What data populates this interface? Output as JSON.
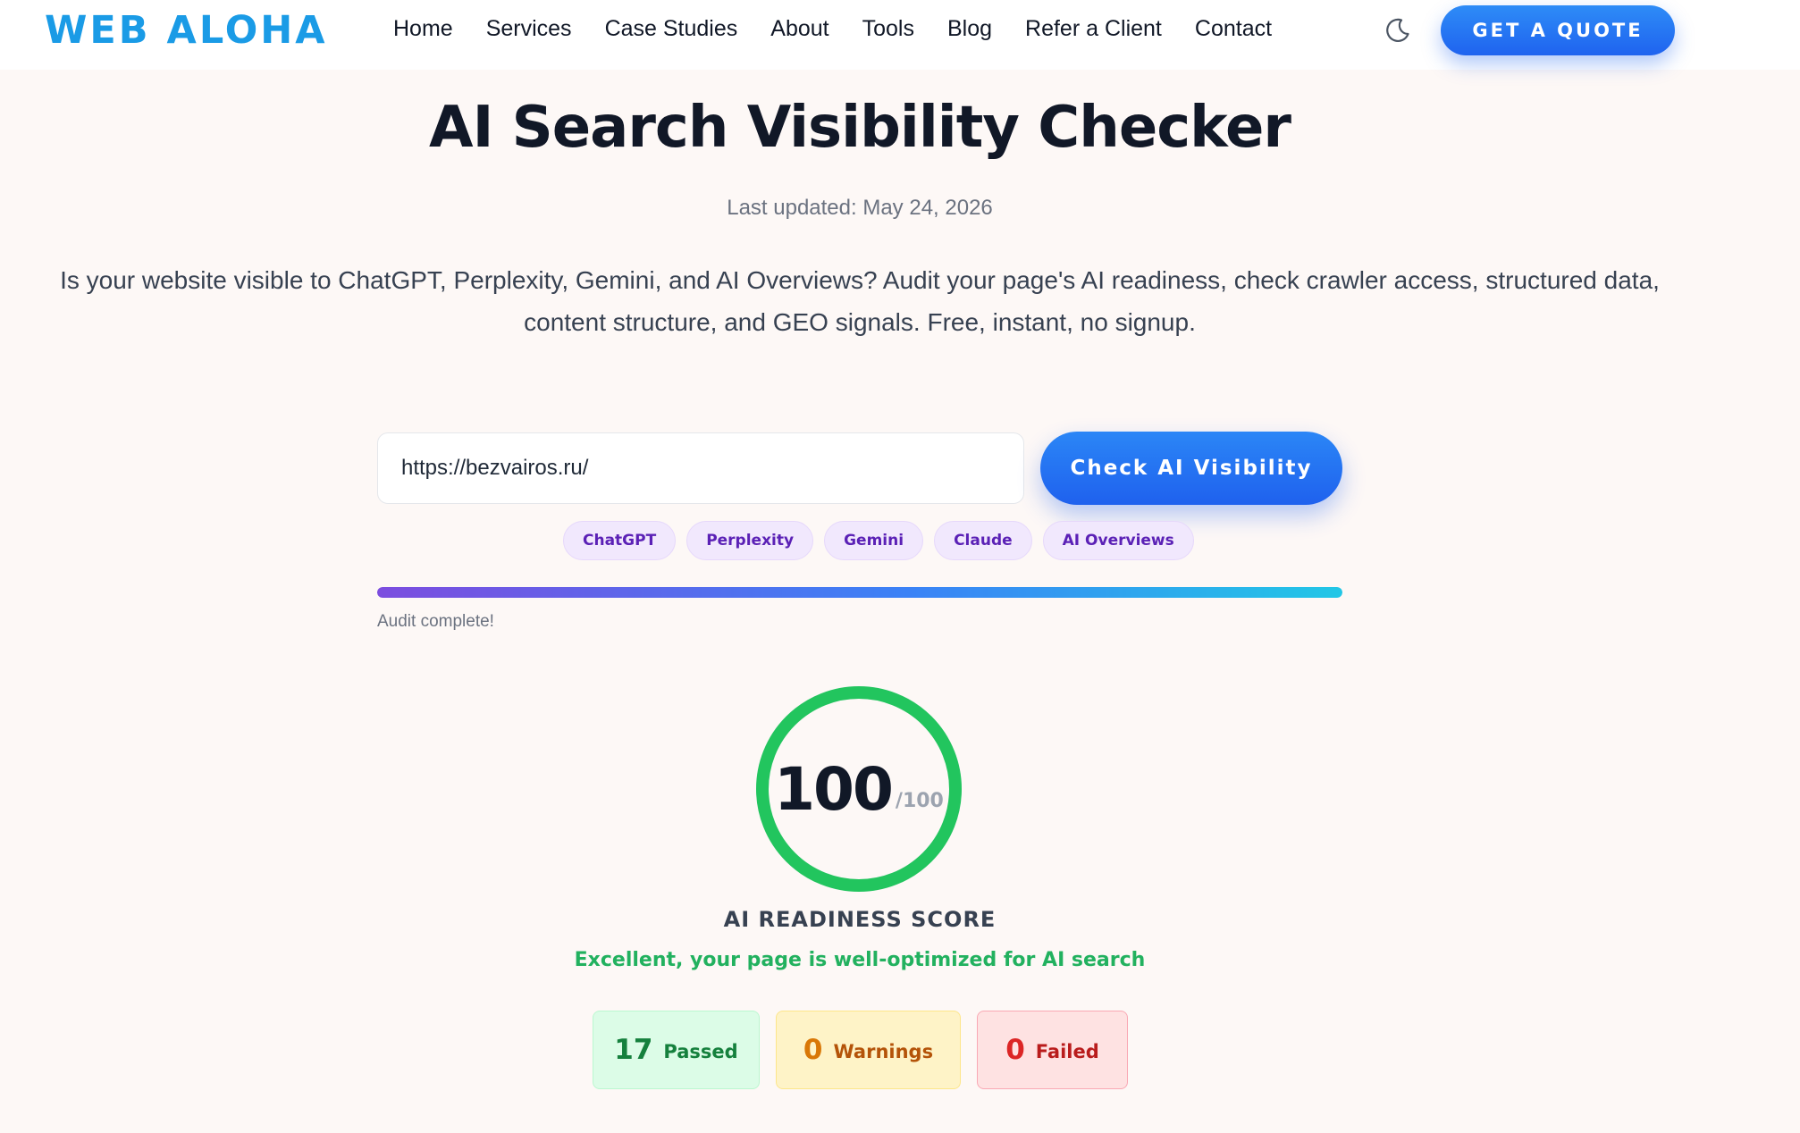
{
  "nav": {
    "logo": "WEB ALOHA",
    "links": [
      "Home",
      "Services",
      "Case Studies",
      "About",
      "Tools",
      "Blog",
      "Refer a Client",
      "Contact"
    ],
    "theme_toggle_icon": "moon-icon",
    "cta_label": "GET A QUOTE"
  },
  "hero": {
    "title": "AI Search Visibility Checker",
    "updated": "Last updated: May 24, 2026",
    "intro": "Is your website visible to ChatGPT, Perplexity, Gemini, and AI Overviews? Audit your page's AI readiness, check crawler access, structured data, content structure, and GEO signals. Free, instant, no signup."
  },
  "form": {
    "url_value": "https://bezvairos.ru/",
    "submit_label": "Check AI Visibility",
    "engines": [
      "ChatGPT",
      "Perplexity",
      "Gemini",
      "Claude",
      "AI Overviews"
    ],
    "progress_percent": 100,
    "progress_label": "Audit complete!"
  },
  "score": {
    "value": "100",
    "max": "/100",
    "label": "AI READINESS SCORE",
    "message": "Excellent, your page is well-optimized for AI search",
    "ring_color": "#22c55e"
  },
  "stats": {
    "passed": {
      "count": "17",
      "label": "Passed"
    },
    "warnings": {
      "count": "0",
      "label": "Warnings"
    },
    "failed": {
      "count": "0",
      "label": "Failed"
    }
  },
  "colors": {
    "brand": "#1a9be6",
    "accent": "#1f63ef",
    "chip_bg": "#f1e8fd",
    "chip_text": "#5b21b6",
    "success": "#22c55e",
    "warning": "#d97706",
    "danger": "#dc2626"
  }
}
